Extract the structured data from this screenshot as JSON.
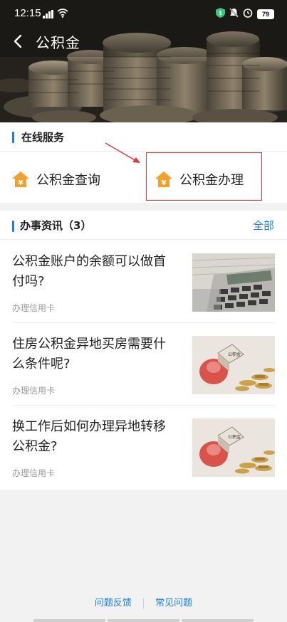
{
  "status_bar": {
    "time": "12:15",
    "battery": "79"
  },
  "nav": {
    "title": "公积金"
  },
  "online_services": {
    "title": "在线服务",
    "items": [
      {
        "label": "公积金查询",
        "icon": "house-yuan-icon"
      },
      {
        "label": "公积金办理",
        "icon": "house-yuan-icon"
      }
    ]
  },
  "news": {
    "title": "办事资讯（3）",
    "all_label": "全部",
    "articles": [
      {
        "title": "公积金账户的余额可以做首付吗?",
        "tag": "办理信用卡",
        "image": "calculator-photo"
      },
      {
        "title": "住房公积金异地买房需要什么条件呢?",
        "tag": "办理信用卡",
        "image": "piggybank-coins-photo"
      },
      {
        "title": "换工作后如何办理异地转移公积金?",
        "tag": "办理信用卡",
        "image": "piggybank-coins-photo"
      }
    ]
  },
  "footer": {
    "feedback": "问题反馈",
    "faq": "常见问题"
  },
  "colors": {
    "accent": "#1a7fe0",
    "icon_orange": "#f2a22b",
    "highlight_red": "#e43a3a"
  }
}
